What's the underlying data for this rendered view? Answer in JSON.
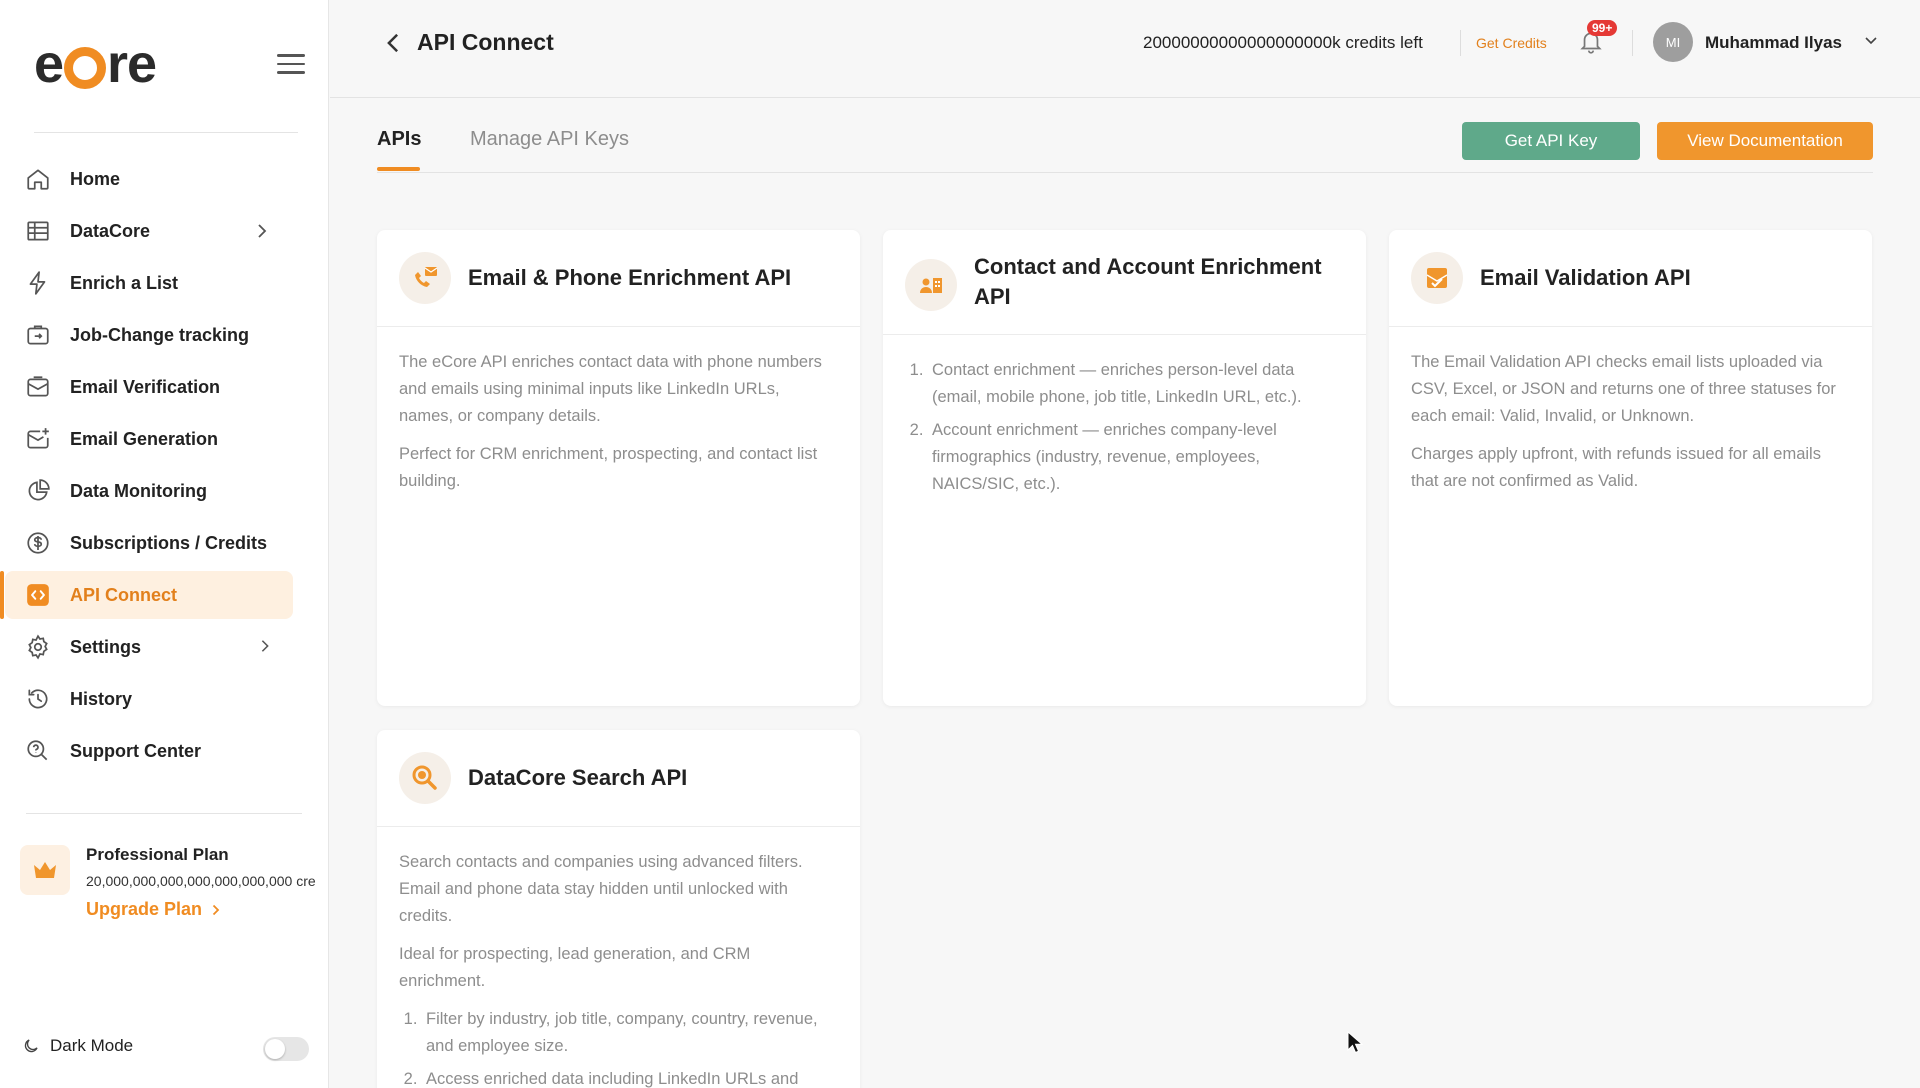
{
  "brand": {
    "logo_text": "eCore",
    "accent": "#f08c22"
  },
  "sidebar": {
    "items": [
      {
        "label": "Home",
        "icon": "home-icon"
      },
      {
        "label": "DataCore",
        "icon": "table-icon",
        "has_submenu": true
      },
      {
        "label": "Enrich a List",
        "icon": "lightning-icon"
      },
      {
        "label": "Job-Change tracking",
        "icon": "briefcase-icon"
      },
      {
        "label": "Email Verification",
        "icon": "email-check-icon"
      },
      {
        "label": "Email Generation",
        "icon": "email-plus-icon"
      },
      {
        "label": "Data Monitoring",
        "icon": "pie-chart-icon"
      },
      {
        "label": "Subscriptions / Credits",
        "icon": "dollar-icon"
      },
      {
        "label": "API Connect",
        "icon": "code-icon",
        "active": true
      },
      {
        "label": "Settings",
        "icon": "gear-icon",
        "has_submenu": true
      },
      {
        "label": "History",
        "icon": "history-icon"
      },
      {
        "label": "Support Center",
        "icon": "support-icon"
      }
    ],
    "plan": {
      "title": "Professional Plan",
      "credits": "20,000,000,000,000,000,000,000 cre",
      "upgrade_label": "Upgrade Plan"
    },
    "dark_mode": {
      "label": "Dark Mode",
      "enabled": false
    }
  },
  "header": {
    "title": "API Connect",
    "credits_left": "20000000000000000000k credits left",
    "get_credits_label": "Get Credits",
    "notification_badge": "99+",
    "user": {
      "initials": "MI",
      "name": "Muhammad Ilyas"
    }
  },
  "tabs": [
    {
      "label": "APIs",
      "active": true
    },
    {
      "label": "Manage API Keys",
      "active": false
    }
  ],
  "actions": {
    "get_api_key": "Get API Key",
    "view_docs": "View Documentation"
  },
  "cards": [
    {
      "title": "Email & Phone Enrichment API",
      "icon": "phone-email-icon",
      "paragraphs": [
        "The eCore API enriches contact data with phone numbers and emails using minimal inputs like LinkedIn URLs, names, or company details.",
        "Perfect for CRM enrichment, prospecting, and contact list building."
      ]
    },
    {
      "title": "Contact and Account Enrichment API",
      "icon": "contact-building-icon",
      "list": [
        "Contact enrichment — enriches person-level data (email, mobile phone, job title, LinkedIn URL, etc.).",
        "Account enrichment — enriches company-level firmographics (industry, revenue, employees, NAICS/SIC, etc.)."
      ]
    },
    {
      "title": "Email Validation API",
      "icon": "email-validation-icon",
      "paragraphs": [
        "The Email Validation API checks email lists uploaded via CSV, Excel, or JSON and returns one of three statuses for each email: Valid, Invalid, or Unknown.",
        "Charges apply upfront, with refunds issued for all emails that are not confirmed as Valid."
      ]
    },
    {
      "title": "DataCore Search API",
      "icon": "search-icon",
      "paragraphs": [
        "Search contacts and companies using advanced filters. Email and phone data stay hidden until unlocked with credits.",
        "Ideal for prospecting, lead generation, and CRM enrichment."
      ],
      "list": [
        "Filter by industry, job title, company, country, revenue, and employee size.",
        "Access enriched data including LinkedIn URLs and"
      ]
    }
  ]
}
